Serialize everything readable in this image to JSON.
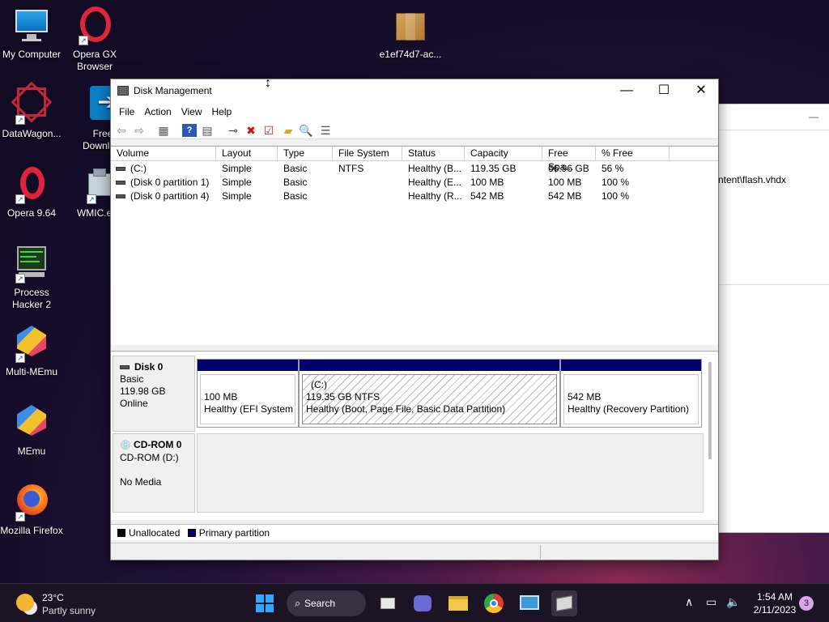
{
  "desktop": {
    "icons": [
      {
        "label": "My Computer"
      },
      {
        "label": "Opera GX Browser"
      },
      {
        "label": "e1ef74d7-ac..."
      },
      {
        "label": "DataWagon..."
      },
      {
        "label": "Free Downlo..."
      },
      {
        "label": "Opera 9.64"
      },
      {
        "label": "WMIC.exe"
      },
      {
        "label": "Process Hacker 2"
      },
      {
        "label": "Multi-MEmu"
      },
      {
        "label": "MEmu"
      },
      {
        "label": "Mozilla Firefox"
      }
    ]
  },
  "background_window": {
    "path_text": "ntent\\flash.vhdx",
    "minimize_glyph": "—"
  },
  "window": {
    "title": "Disk Management",
    "min_glyph": "—",
    "max_glyph": "☐",
    "close_glyph": "✕",
    "menu": [
      "File",
      "Action",
      "View",
      "Help"
    ]
  },
  "volume_list": {
    "columns": [
      "Volume",
      "Layout",
      "Type",
      "File System",
      "Status",
      "Capacity",
      "Free Spa...",
      "% Free"
    ],
    "rows": [
      {
        "volume": "(C:)",
        "layout": "Simple",
        "type": "Basic",
        "fs": "NTFS",
        "status": "Healthy (B...",
        "capacity": "119.35 GB",
        "free": "66.96 GB",
        "pct": "56 %"
      },
      {
        "volume": "(Disk 0 partition 1)",
        "layout": "Simple",
        "type": "Basic",
        "fs": "",
        "status": "Healthy (E...",
        "capacity": "100 MB",
        "free": "100 MB",
        "pct": "100 %"
      },
      {
        "volume": "(Disk 0 partition 4)",
        "layout": "Simple",
        "type": "Basic",
        "fs": "",
        "status": "Healthy (R...",
        "capacity": "542 MB",
        "free": "542 MB",
        "pct": "100 %"
      }
    ]
  },
  "disks": {
    "disk0": {
      "name": "Disk 0",
      "type": "Basic",
      "size": "119.98 GB",
      "state": "Online"
    },
    "cdrom0": {
      "name": "CD-ROM 0",
      "drive": "CD-ROM (D:)",
      "media": "No Media"
    },
    "partitions": [
      {
        "title": "",
        "size": "100 MB",
        "status": "Healthy (EFI System Partition)"
      },
      {
        "title": "(C:)",
        "size": "119.35 GB NTFS",
        "status": "Healthy (Boot, Page File, Basic Data Partition)"
      },
      {
        "title": "",
        "size": "542 MB",
        "status": "Healthy (Recovery Partition)"
      }
    ]
  },
  "legend": {
    "unallocated": "Unallocated",
    "primary": "Primary partition",
    "unallocated_color": "#000000",
    "primary_color": "#00006e"
  },
  "taskbar": {
    "temp": "23°C",
    "condition": "Partly sunny",
    "search_label": "Search",
    "time": "1:54 AM",
    "date": "2/11/2023",
    "notification_count": "3",
    "chevron": "∧"
  }
}
